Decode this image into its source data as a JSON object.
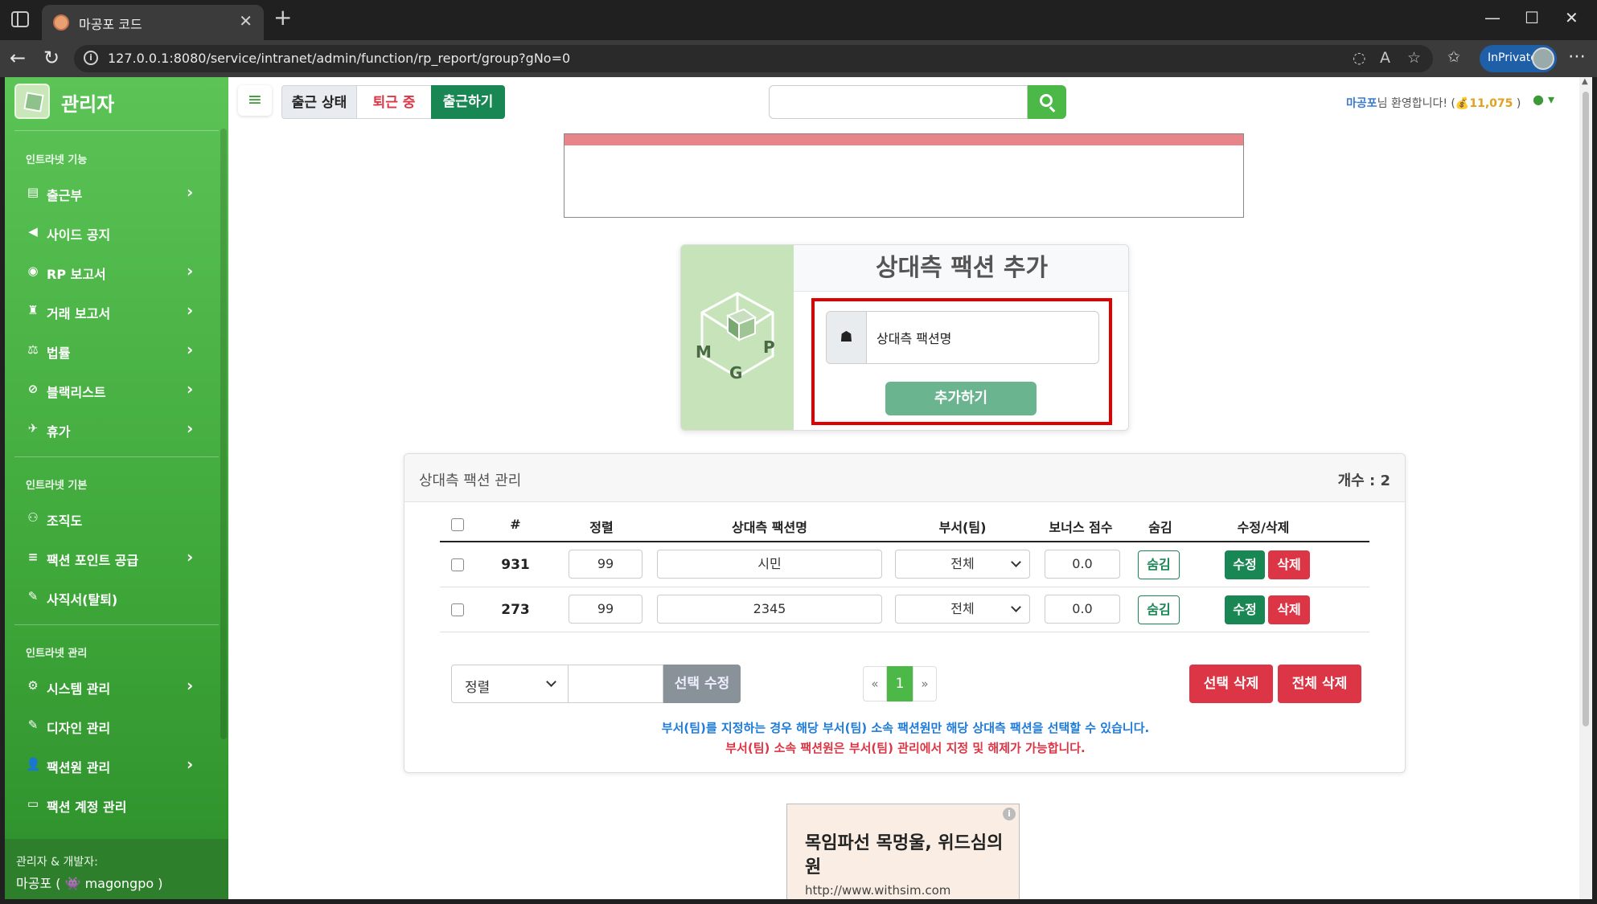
{
  "browser": {
    "tab_title": "마공포 코드",
    "url": "127.0.0.1:8080/service/intranet/admin/function/rp_report/group?gNo=0",
    "inprivate_label": "InPrivate"
  },
  "sidebar": {
    "brand": "관리자",
    "sections": [
      {
        "heading": "인트라넷 기능",
        "items": [
          {
            "label": "출근부",
            "icon": "book-icon",
            "chevron": true
          },
          {
            "label": "사이드 공지",
            "icon": "megaphone-icon",
            "chevron": false
          },
          {
            "label": "RP 보고서",
            "icon": "gamepad-icon",
            "chevron": true
          },
          {
            "label": "거래 보고서",
            "icon": "money-bag-icon",
            "chevron": true
          },
          {
            "label": "법률",
            "icon": "scale-icon",
            "chevron": true
          },
          {
            "label": "블랙리스트",
            "icon": "ban-icon",
            "chevron": true
          },
          {
            "label": "휴가",
            "icon": "plane-icon",
            "chevron": true
          }
        ]
      },
      {
        "heading": "인트라넷 기본",
        "items": [
          {
            "label": "조직도",
            "icon": "sitemap-icon",
            "chevron": false
          },
          {
            "label": "팩션 포인트 공급",
            "icon": "coins-icon",
            "chevron": true
          },
          {
            "label": "사직서(탈퇴)",
            "icon": "feather-icon",
            "chevron": false
          }
        ]
      },
      {
        "heading": "인트라넷 관리",
        "items": [
          {
            "label": "시스템 관리",
            "icon": "gear-icon",
            "chevron": true
          },
          {
            "label": "디자인 관리",
            "icon": "brush-icon",
            "chevron": false
          },
          {
            "label": "팩션원 관리",
            "icon": "user-gear-icon",
            "chevron": true
          },
          {
            "label": "팩션 계정 관리",
            "icon": "id-card-icon",
            "chevron": false
          }
        ]
      }
    ],
    "footer_line1": "관리자 & 개발자:",
    "footer_line2": "마공포 ( 👾 magongpo )"
  },
  "topbar": {
    "status_label": "출근 상태",
    "status_value": "퇴근 중",
    "checkin_label": "출근하기",
    "welcome_name": "마공포",
    "welcome_text": "님 환영합니다! (",
    "points": "💰11,075",
    "welcome_close": " )"
  },
  "add_faction": {
    "title": "상대측 팩션 추가",
    "input_placeholder": "상대측 팩션명",
    "submit_label": "추가하기"
  },
  "manage": {
    "title": "상대측 팩션 관리",
    "count_label": "개수 : 2",
    "columns": [
      "#",
      "정렬",
      "상대측 팩션명",
      "부서(팀)",
      "보너스 점수",
      "숨김",
      "수정/삭제"
    ],
    "rows": [
      {
        "id": "931",
        "order": "99",
        "name": "시민",
        "dept": "전체",
        "bonus": "0.0",
        "hide": "숨김",
        "edit": "수정",
        "delete": "삭제"
      },
      {
        "id": "273",
        "order": "99",
        "name": "2345",
        "dept": "전체",
        "bonus": "0.0",
        "hide": "숨김",
        "edit": "수정",
        "delete": "삭제"
      }
    ],
    "bulk_select": "정렬",
    "bulk_edit_label": "선택 수정",
    "pagination": [
      "«",
      "1",
      "»"
    ],
    "delete_selected_label": "선택 삭제",
    "delete_all_label": "전체 삭제",
    "note_blue": "부서(팀)를 지정하는 경우 해당 부서(팀) 소속 팩션원만 해당 상대측 팩션을 선택할 수 있습니다.",
    "note_red": "부서(팀) 소속 팩션원은 부서(팀) 관리에서 지정 및 해제가 가능합니다."
  },
  "ad": {
    "headline": "목임파선 목멍울, 위드심의원",
    "url": "http://www.withsim.com"
  }
}
